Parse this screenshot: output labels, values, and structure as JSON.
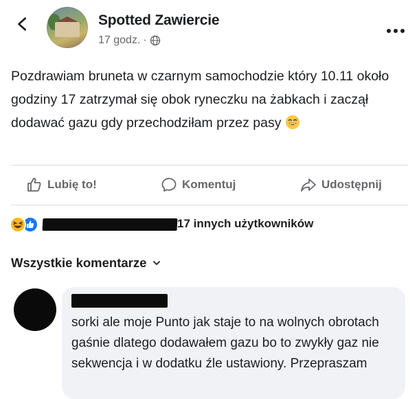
{
  "header": {
    "page_name": "Spotted Zawiercie",
    "timestamp": "17 godz.",
    "separator": "·",
    "back_icon": "chevron-left-icon",
    "privacy_icon": "globe-icon",
    "more_icon": "more-horizontal-icon"
  },
  "post": {
    "text": "Pozdrawiam bruneta w czarnym samochodzie który 10.11 około godziny 17 zatrzymał się obok ryneczku na żabkach i zaczął dodawać gazu gdy przechodziłam przez pasy",
    "emoji": "grinning-sweat-emoji"
  },
  "actions": {
    "like_label": "Lubię to!",
    "comment_label": "Komentuj",
    "share_label": "Udostępnij"
  },
  "reactions": {
    "types": [
      "haha",
      "like"
    ],
    "others_text": "17 innych użytkowników"
  },
  "comments": {
    "filter_label": "Wszystkie komentarze",
    "items": [
      {
        "text": "sorki ale moje Punto jak staje to na wolnych obrotach gaśnie dlatego dodawałem gazu bo to zwykły gaz nie sekwencja i w dodatku źle ustawiony. Przepraszam"
      }
    ]
  },
  "colors": {
    "text": "#1c1e21",
    "muted": "#65676b",
    "like_blue": "#1877f2",
    "haha_yellow": "#f7b928",
    "bubble": "#f0f2f5"
  }
}
